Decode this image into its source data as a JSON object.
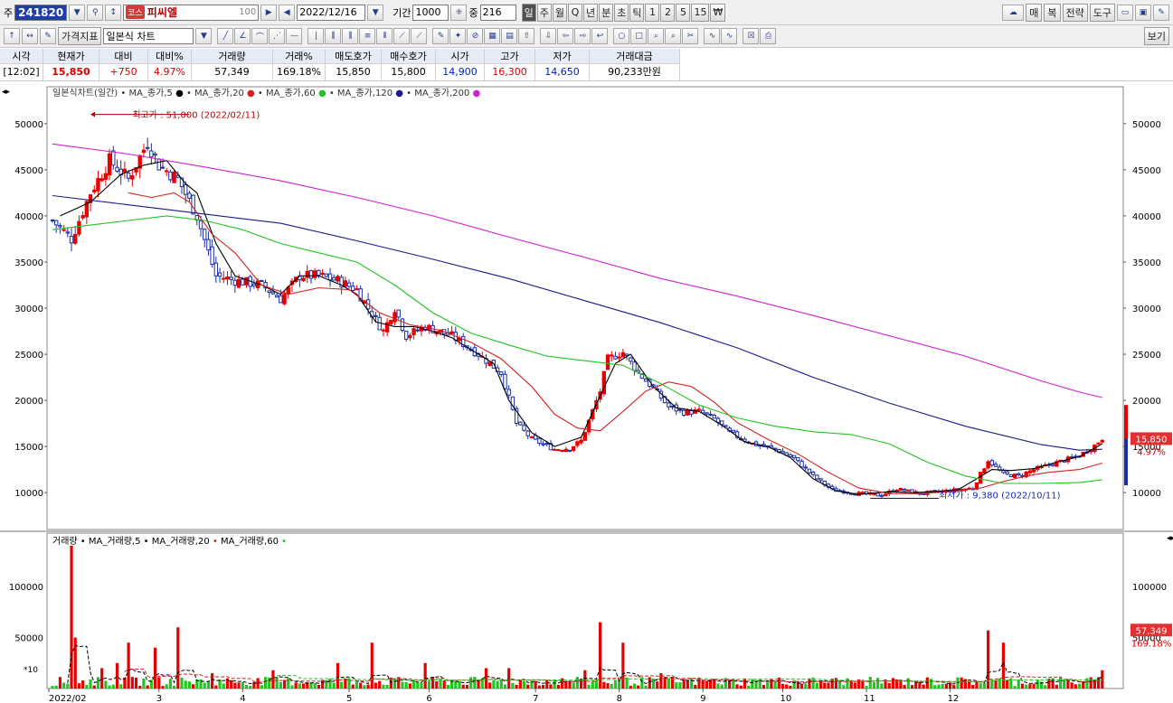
{
  "toolbar": {
    "prefix": "주",
    "code": "241820",
    "market_tag": "코스",
    "stock_name": "피씨엘",
    "stock_value": "100",
    "date": "2022/12/16",
    "period_label": "기간",
    "period_value": "1000",
    "count_label": "중",
    "count_value": "216",
    "period_buttons": [
      "일",
      "주",
      "월",
      "Q",
      "년",
      "분",
      "초",
      "틱",
      "1",
      "2",
      "5",
      "15",
      "₩"
    ],
    "active_period": "일",
    "right_buttons": [
      "매",
      "복",
      "전략",
      "도구"
    ],
    "indicator_button": "가격지표",
    "chart_type": "일본식 차트",
    "view_button": "보기"
  },
  "quote": {
    "headers": [
      "시각",
      "현재가",
      "대비",
      "대비%",
      "거래량",
      "거래%",
      "매도호가",
      "매수호가",
      "시가",
      "고가",
      "저가",
      "거래대금"
    ],
    "values": [
      "[12:02]",
      "15,850",
      "+750",
      "4.97%",
      "57,349",
      "169.18%",
      "15,850",
      "15,800",
      "14,900",
      "16,300",
      "14,650",
      "90,233만원"
    ]
  },
  "colors": {
    "up": "#e60000",
    "down": "#1a2ea8",
    "ma5": "#000000",
    "ma20": "#d42020",
    "ma60": "#22c422",
    "ma120": "#1a1a8c",
    "ma200": "#d020d0"
  },
  "chart_data": [
    {
      "type": "candlestick",
      "title": "일본식차트(일간)",
      "legend": [
        "MA_종가,5",
        "MA_종가,20",
        "MA_종가,60",
        "MA_종가,120",
        "MA_종가,200"
      ],
      "x_ticks": [
        "2022/02",
        "3",
        "4",
        "5",
        "6",
        "7",
        "8",
        "9",
        "10",
        "11",
        "12"
      ],
      "y_ticks": [
        10000,
        15000,
        20000,
        25000,
        30000,
        35000,
        40000,
        45000,
        50000
      ],
      "ylim": [
        6000,
        54000
      ],
      "annotations": [
        "최고가 : 51,000 (2022/02/11)",
        "최저가 : 9,380 (2022/10/11)"
      ],
      "current_price_label": "15,850",
      "current_change_label": "4.97%",
      "anchors": [
        [
          0,
          39500
        ],
        [
          5,
          37500
        ],
        [
          10,
          42500
        ],
        [
          15,
          46000
        ],
        [
          20,
          44000
        ],
        [
          25,
          48000
        ],
        [
          28,
          45500
        ],
        [
          33,
          44000
        ],
        [
          38,
          40000
        ],
        [
          43,
          33500
        ],
        [
          48,
          33000
        ],
        [
          55,
          32500
        ],
        [
          60,
          31000
        ],
        [
          65,
          33500
        ],
        [
          70,
          33500
        ],
        [
          75,
          33000
        ],
        [
          80,
          32000
        ],
        [
          83,
          30000
        ],
        [
          87,
          27500
        ],
        [
          90,
          30000
        ],
        [
          93,
          27000
        ],
        [
          98,
          28000
        ],
        [
          105,
          27000
        ],
        [
          112,
          25000
        ],
        [
          118,
          23000
        ],
        [
          122,
          17500
        ],
        [
          126,
          15800
        ],
        [
          132,
          14700
        ],
        [
          136,
          14800
        ],
        [
          139,
          15600
        ],
        [
          144,
          21000
        ],
        [
          146,
          24500
        ],
        [
          150,
          25200
        ],
        [
          154,
          23000
        ],
        [
          158,
          21300
        ],
        [
          162,
          19300
        ],
        [
          166,
          18700
        ],
        [
          170,
          18800
        ],
        [
          174,
          18000
        ],
        [
          178,
          16500
        ],
        [
          184,
          15300
        ],
        [
          190,
          14700
        ],
        [
          195,
          13700
        ],
        [
          200,
          11800
        ],
        [
          205,
          10300
        ],
        [
          212,
          9900
        ],
        [
          218,
          9700
        ],
        [
          222,
          10400
        ],
        [
          228,
          9900
        ],
        [
          233,
          10100
        ],
        [
          238,
          10300
        ],
        [
          242,
          10500
        ],
        [
          246,
          13500
        ],
        [
          250,
          12000
        ],
        [
          254,
          11800
        ],
        [
          258,
          12500
        ],
        [
          262,
          13000
        ],
        [
          266,
          13500
        ],
        [
          270,
          14000
        ],
        [
          274,
          15100
        ],
        [
          276,
          15850
        ]
      ],
      "ma": [
        {
          "name": "MA_종가,5",
          "points": [
            [
              2,
              40000
            ],
            [
              10,
              41500
            ],
            [
              18,
              44500
            ],
            [
              24,
              45500
            ],
            [
              30,
              46000
            ],
            [
              35,
              43500
            ],
            [
              38,
              42500
            ],
            [
              43,
              37000
            ],
            [
              48,
              33500
            ],
            [
              55,
              32500
            ],
            [
              60,
              31500
            ],
            [
              65,
              33500
            ],
            [
              70,
              33500
            ],
            [
              76,
              32500
            ],
            [
              80,
              31500
            ],
            [
              85,
              28500
            ],
            [
              90,
              28000
            ],
            [
              95,
              28000
            ],
            [
              100,
              27500
            ],
            [
              105,
              26800
            ],
            [
              110,
              25500
            ],
            [
              116,
              24000
            ],
            [
              120,
              20000
            ],
            [
              126,
              16500
            ],
            [
              132,
              15000
            ],
            [
              139,
              16000
            ],
            [
              144,
              20500
            ],
            [
              148,
              24000
            ],
            [
              152,
              25000
            ],
            [
              158,
              21500
            ],
            [
              164,
              19200
            ],
            [
              170,
              18800
            ],
            [
              176,
              17300
            ],
            [
              182,
              15500
            ],
            [
              188,
              15000
            ],
            [
              194,
              13800
            ],
            [
              200,
              11500
            ],
            [
              206,
              10200
            ],
            [
              212,
              9800
            ],
            [
              220,
              10100
            ],
            [
              226,
              10000
            ],
            [
              232,
              10100
            ],
            [
              238,
              10300
            ],
            [
              243,
              11500
            ],
            [
              247,
              12500
            ],
            [
              252,
              12400
            ],
            [
              258,
              12600
            ],
            [
              264,
              13300
            ],
            [
              270,
              13900
            ],
            [
              276,
              15300
            ]
          ]
        },
        {
          "name": "MA_종가,20",
          "points": [
            [
              20,
              42500
            ],
            [
              26,
              42000
            ],
            [
              32,
              42500
            ],
            [
              36,
              41500
            ],
            [
              42,
              38000
            ],
            [
              48,
              36000
            ],
            [
              55,
              32500
            ],
            [
              62,
              31500
            ],
            [
              70,
              32200
            ],
            [
              78,
              32000
            ],
            [
              86,
              29500
            ],
            [
              94,
              28200
            ],
            [
              102,
              27600
            ],
            [
              110,
              26300
            ],
            [
              118,
              24500
            ],
            [
              126,
              21500
            ],
            [
              132,
              18500
            ],
            [
              138,
              17000
            ],
            [
              144,
              16700
            ],
            [
              150,
              18800
            ],
            [
              156,
              21000
            ],
            [
              162,
              22000
            ],
            [
              168,
              21500
            ],
            [
              174,
              19800
            ],
            [
              180,
              17600
            ],
            [
              188,
              15800
            ],
            [
              196,
              14200
            ],
            [
              204,
              12200
            ],
            [
              212,
              10500
            ],
            [
              220,
              9900
            ],
            [
              228,
              9900
            ],
            [
              236,
              10100
            ],
            [
              244,
              10500
            ],
            [
              250,
              11200
            ],
            [
              256,
              11800
            ],
            [
              262,
              12200
            ],
            [
              270,
              12500
            ],
            [
              276,
              13200
            ]
          ]
        },
        {
          "name": "MA_종가,60",
          "points": [
            [
              0,
              38500
            ],
            [
              10,
              39000
            ],
            [
              20,
              39500
            ],
            [
              30,
              40000
            ],
            [
              40,
              39500
            ],
            [
              50,
              38500
            ],
            [
              60,
              37000
            ],
            [
              70,
              36000
            ],
            [
              80,
              35000
            ],
            [
              90,
              32500
            ],
            [
              100,
              29500
            ],
            [
              110,
              27300
            ],
            [
              120,
              26000
            ],
            [
              130,
              24800
            ],
            [
              140,
              24300
            ],
            [
              150,
              23800
            ],
            [
              160,
              21800
            ],
            [
              170,
              19500
            ],
            [
              180,
              18100
            ],
            [
              190,
              17200
            ],
            [
              200,
              16600
            ],
            [
              210,
              16300
            ],
            [
              220,
              15300
            ],
            [
              230,
              13300
            ],
            [
              240,
              11800
            ],
            [
              250,
              11000
            ],
            [
              260,
              11000
            ],
            [
              270,
              11100
            ],
            [
              276,
              11400
            ]
          ]
        },
        {
          "name": "MA_종가,120",
          "points": [
            [
              0,
              42200
            ],
            [
              20,
              41200
            ],
            [
              40,
              40200
            ],
            [
              60,
              39200
            ],
            [
              80,
              37300
            ],
            [
              100,
              35300
            ],
            [
              120,
              33200
            ],
            [
              140,
              30800
            ],
            [
              160,
              28400
            ],
            [
              180,
              25700
            ],
            [
              200,
              22500
            ],
            [
              220,
              19700
            ],
            [
              240,
              17200
            ],
            [
              260,
              15200
            ],
            [
              270,
              14600
            ],
            [
              276,
              14700
            ]
          ]
        },
        {
          "name": "MA_종가,200",
          "points": [
            [
              0,
              47800
            ],
            [
              20,
              46700
            ],
            [
              40,
              45300
            ],
            [
              60,
              43800
            ],
            [
              80,
              42000
            ],
            [
              100,
              40000
            ],
            [
              120,
              37700
            ],
            [
              140,
              35500
            ],
            [
              160,
              33200
            ],
            [
              180,
              31300
            ],
            [
              200,
              29200
            ],
            [
              220,
              27000
            ],
            [
              240,
              24800
            ],
            [
              260,
              22100
            ],
            [
              270,
              20900
            ],
            [
              276,
              20300
            ]
          ]
        }
      ]
    },
    {
      "type": "bar",
      "title": "거래량",
      "legend": [
        "MA_거래량,5",
        "MA_거래량,20",
        "MA_거래량,60"
      ],
      "y_ticks": [
        50000,
        100000
      ],
      "y_axis_note": "*10",
      "ylim": [
        0,
        140000
      ],
      "current_volume_label": "57,349",
      "current_volume_pct_label": "169.18%",
      "spikes": [
        [
          5,
          140000
        ],
        [
          6,
          50000
        ],
        [
          13,
          20000
        ],
        [
          17,
          25000
        ],
        [
          20,
          45000
        ],
        [
          27,
          40000
        ],
        [
          33,
          60000
        ],
        [
          42,
          15000
        ],
        [
          58,
          18000
        ],
        [
          75,
          25000
        ],
        [
          84,
          45000
        ],
        [
          98,
          25000
        ],
        [
          114,
          20000
        ],
        [
          120,
          20000
        ],
        [
          140,
          18000
        ],
        [
          144,
          65000
        ],
        [
          150,
          45000
        ],
        [
          160,
          15000
        ],
        [
          210,
          8000
        ],
        [
          246,
          57000
        ],
        [
          250,
          45000
        ],
        [
          276,
          18000
        ]
      ]
    }
  ]
}
